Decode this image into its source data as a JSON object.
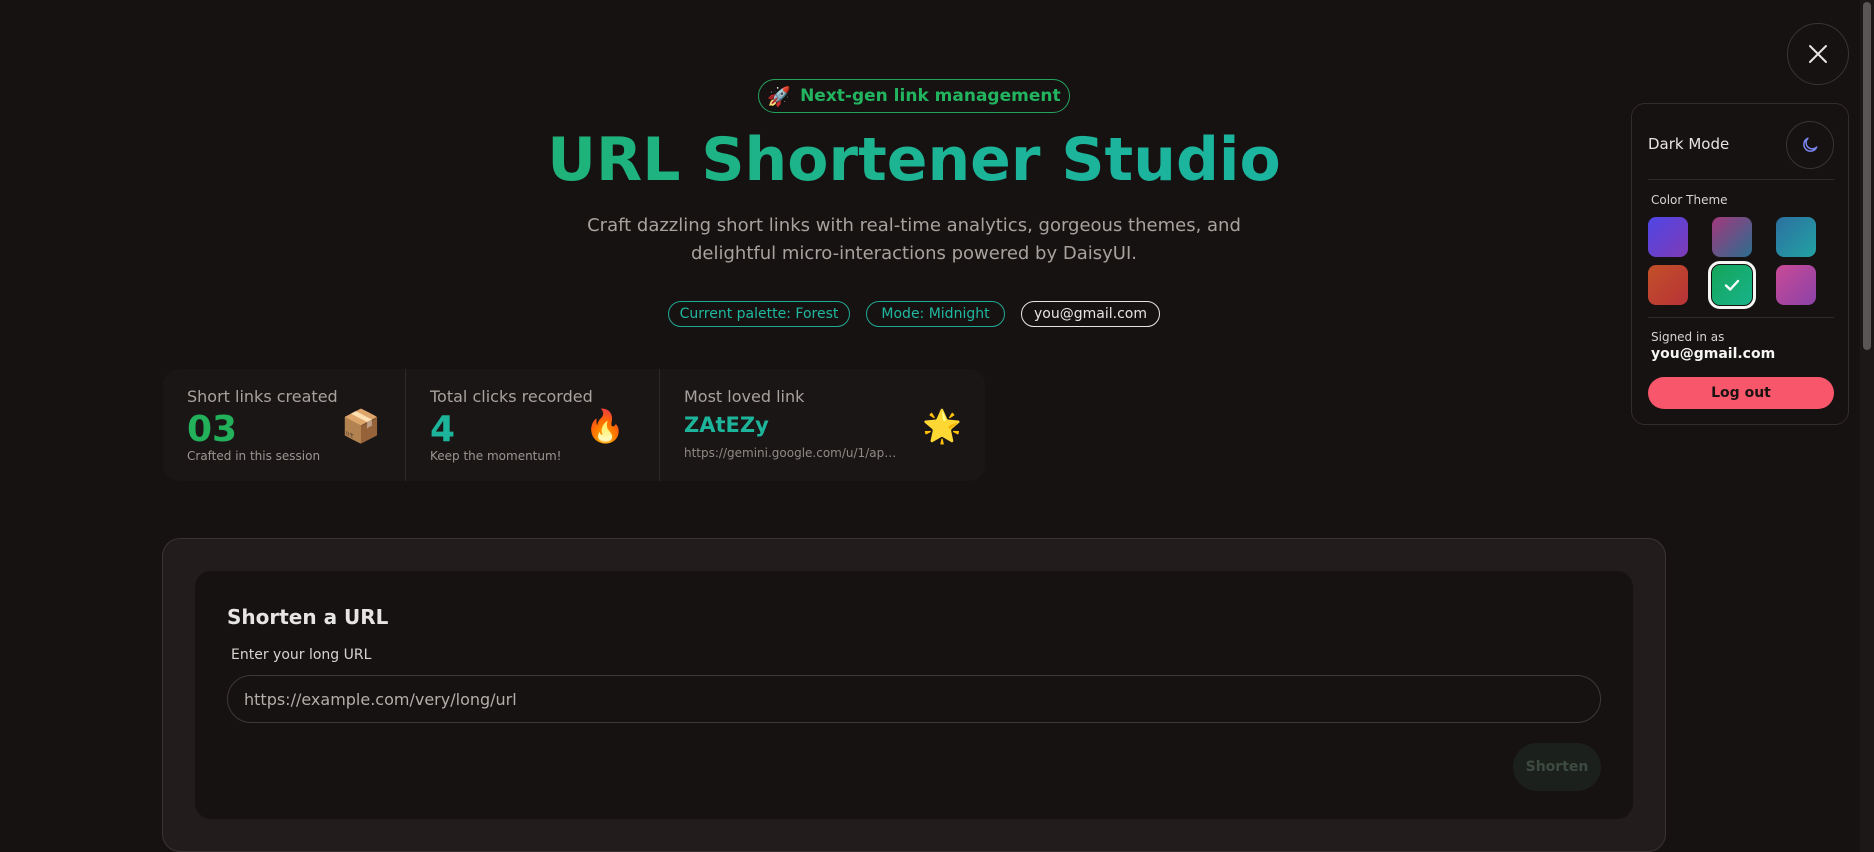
{
  "hero": {
    "badge_icon": "rocket-emoji",
    "badge_icon_glyph": "🚀",
    "badge_label": "Next-gen link management",
    "title": "URL Shortener Studio",
    "subtitle": "Craft dazzling short links with real-time analytics, gorgeous themes, and delightful micro-interactions powered by DaisyUI.",
    "pills": {
      "palette": "Current palette: Forest",
      "mode": "Mode: Midnight",
      "email": "you@gmail.com"
    }
  },
  "stats": {
    "links": {
      "title": "Short links created",
      "value": "03",
      "desc": "Crafted in this session",
      "icon": "package-emoji",
      "icon_glyph": "📦",
      "value_color": "#22b15a"
    },
    "clicks": {
      "title": "Total clicks recorded",
      "value": "4",
      "desc": "Keep the momentum!",
      "icon": "fire-emoji",
      "icon_glyph": "🔥",
      "value_color": "#1cb49a"
    },
    "loved": {
      "title": "Most loved link",
      "code": "ZAtEZy",
      "url": "https://gemini.google.com/u/1/app/f...",
      "icon": "star-emoji",
      "icon_glyph": "🌟"
    }
  },
  "shorten_form": {
    "title": "Shorten a URL",
    "input_label": "Enter your long URL",
    "input_placeholder": "https://example.com/very/long/url",
    "input_value": "",
    "submit_label": "Shorten"
  },
  "settings_panel": {
    "close_icon": "close-icon",
    "dark_mode_label": "Dark Mode",
    "dark_mode_icon": "moon-icon",
    "color_theme_label": "Color Theme",
    "themes": [
      {
        "name": "indigo-purple",
        "gradient": [
          "#4f46e5",
          "#7e3bb6"
        ],
        "selected": false
      },
      {
        "name": "purple-teal",
        "gradient": [
          "#a3387d",
          "#2a6e8f"
        ],
        "selected": false
      },
      {
        "name": "ocean",
        "gradient": [
          "#2c6fa0",
          "#22a3a3"
        ],
        "selected": false
      },
      {
        "name": "sunset",
        "gradient": [
          "#c25028",
          "#b83238"
        ],
        "selected": false
      },
      {
        "name": "forest",
        "gradient": [
          "#15a45a",
          "#18b38a"
        ],
        "selected": true
      },
      {
        "name": "magenta",
        "gradient": [
          "#c94a96",
          "#8b42a8"
        ],
        "selected": false
      }
    ],
    "signed_in_label": "Signed in as",
    "signed_in_email": "you@gmail.com",
    "logout_label": "Log out"
  },
  "colors": {
    "accent_green": "#22b15a",
    "accent_teal": "#1cb49a",
    "logout_red": "#f8566b",
    "background": "#171212"
  }
}
